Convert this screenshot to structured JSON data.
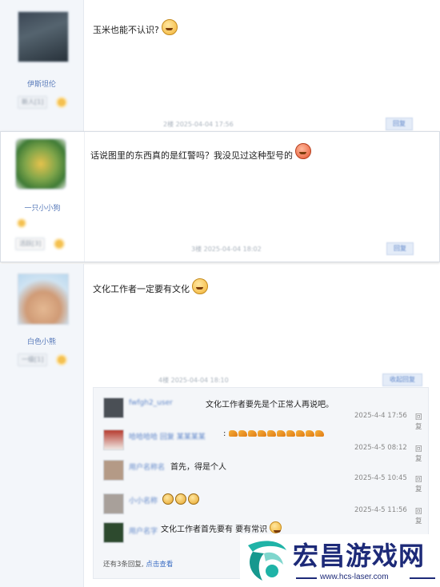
{
  "posts": [
    {
      "content": "玉米也能不认识?",
      "username": "伊斯坦伦",
      "badge": "新人[1]",
      "meta": "2楼 2025-04-04 17:56",
      "reply_label": "回复"
    },
    {
      "content": "话说图里的东西真的是红警吗？我没见过这种型号的",
      "username": "一只小小狗",
      "badge": "活跃[3]",
      "meta": "3楼 2025-04-04 18:02",
      "reply_label": "回复"
    },
    {
      "content": "文化工作者一定要有文化",
      "username": "白色小熊",
      "badge": "一级[1]",
      "meta": "4楼 2025-04-04 18:10",
      "reply_label": "收起回复"
    }
  ],
  "subreplies": [
    {
      "text": "文化工作者要先是个正常人再说吧。",
      "time": "2025-4-4 17:56",
      "reply": "回复",
      "icon": "none"
    },
    {
      "text": ":",
      "time": "2025-4-5 08:12",
      "reply": "回复",
      "icon": "hand-emoji-row"
    },
    {
      "text": "首先，得是个人",
      "time": "2025-4-5 10:45",
      "reply": "回复",
      "icon": "none"
    },
    {
      "text": "",
      "time": "2025-4-5 11:56",
      "reply": "回复",
      "icon": "crying-emoji-row"
    },
    {
      "text": "文化工作者首先要有 要有常识",
      "time": "",
      "reply": "",
      "icon": "smile-emoji"
    }
  ],
  "more": {
    "prefix": "还有3条回复,",
    "link": "点击查看"
  },
  "ad": {
    "brand": "宏昌游戏网",
    "url": "www.hcs-laser.com"
  },
  "colors": {
    "sidebar": "#f3f6fa",
    "link": "#5f86c9",
    "brand": "#1d2a78",
    "accent": "#1fb3a7"
  }
}
